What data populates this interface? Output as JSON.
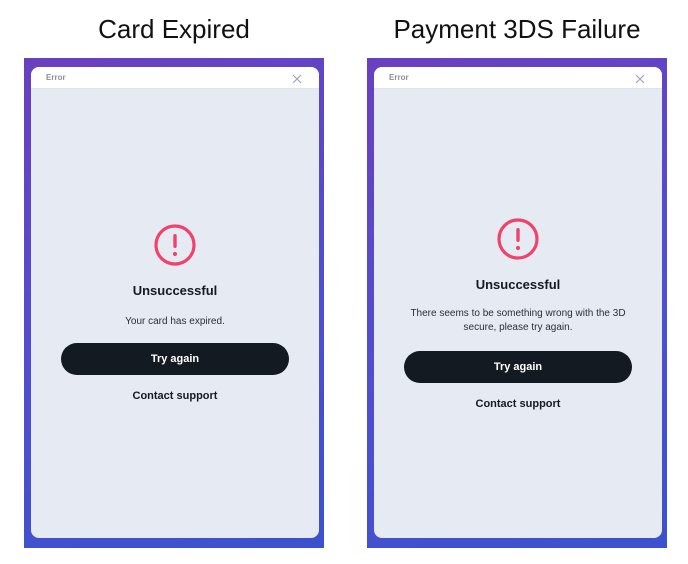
{
  "panels": [
    {
      "heading": "Card Expired",
      "modal_title": "Error",
      "status_title": "Unsuccessful",
      "message": "Your card has expired.",
      "primary_button": "Try again",
      "secondary_link": "Contact support"
    },
    {
      "heading": "Payment 3DS Failure",
      "modal_title": "Error",
      "status_title": "Unsuccessful",
      "message": "There seems to be something wrong with the 3D secure, please try again.",
      "primary_button": "Try again",
      "secondary_link": "Contact support"
    }
  ],
  "icons": {
    "alert": "exclamation-circle-icon",
    "close": "close-icon"
  },
  "colors": {
    "alert_accent": "#f0426b",
    "button_dark": "#141a22",
    "modal_bg": "#e6ebf3",
    "frame_gradient_start": "#6a3fbf",
    "frame_gradient_end": "#3a52cc"
  }
}
